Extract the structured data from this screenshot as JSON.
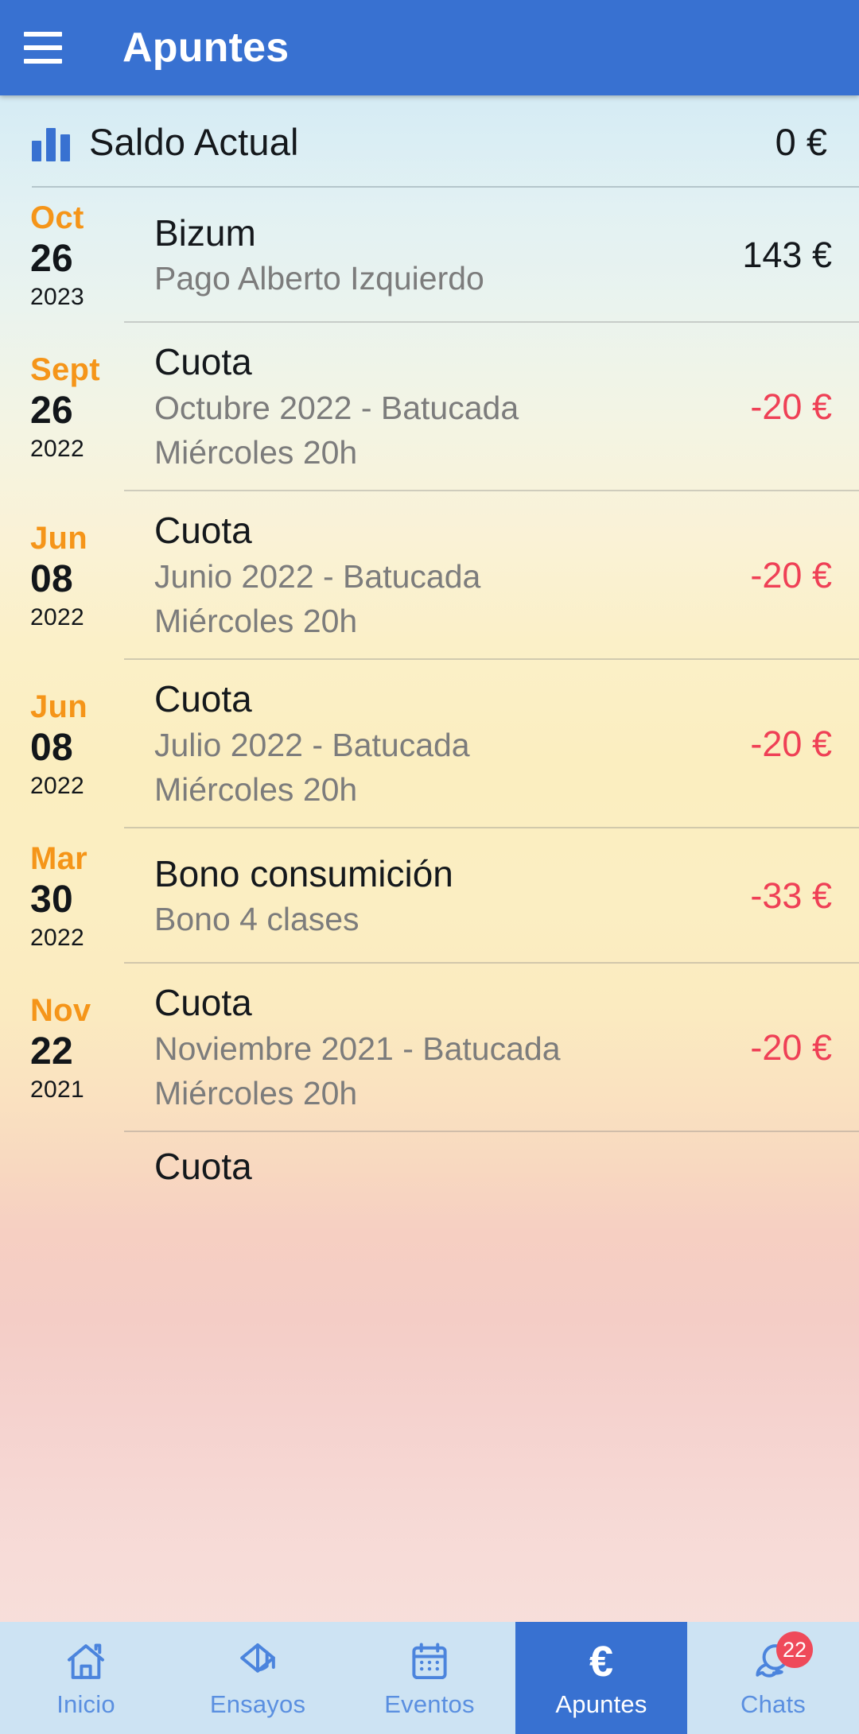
{
  "appbar": {
    "menu_icon": "hamburger-menu-icon",
    "title": "Apuntes"
  },
  "balance": {
    "icon": "bar-chart-icon",
    "label": "Saldo Actual",
    "value": "0 €"
  },
  "colors": {
    "primary_blue": "#3871d1",
    "nav_background": "#cde3f3",
    "month_orange": "#f59519",
    "negative_red": "#ef4056",
    "badge_red": "#ef4a5a",
    "subtitle_grey": "#7c7c7c"
  },
  "transactions": [
    {
      "month": "Oct",
      "day": "26",
      "year": "2023",
      "title": "Bizum",
      "sub1": "Pago Alberto Izquierdo",
      "sub2": "",
      "amount": "143 €",
      "negative": false
    },
    {
      "month": "Sept",
      "day": "26",
      "year": "2022",
      "title": "Cuota",
      "sub1": "Octubre 2022 - Batucada",
      "sub2": "Miércoles 20h",
      "amount": "-20 €",
      "negative": true
    },
    {
      "month": "Jun",
      "day": "08",
      "year": "2022",
      "title": "Cuota",
      "sub1": "Junio 2022 - Batucada",
      "sub2": "Miércoles 20h",
      "amount": "-20 €",
      "negative": true
    },
    {
      "month": "Jun",
      "day": "08",
      "year": "2022",
      "title": "Cuota",
      "sub1": "Julio 2022 - Batucada",
      "sub2": "Miércoles 20h",
      "amount": "-20 €",
      "negative": true
    },
    {
      "month": "Mar",
      "day": "30",
      "year": "2022",
      "title": "Bono consumición",
      "sub1": "Bono 4 clases",
      "sub2": "",
      "amount": "-33 €",
      "negative": true
    },
    {
      "month": "Nov",
      "day": "22",
      "year": "2021",
      "title": "Cuota",
      "sub1": "Noviembre 2021 - Batucada",
      "sub2": "Miércoles 20h",
      "amount": "-20 €",
      "negative": true
    }
  ],
  "partial_transaction": {
    "title": "Cuota"
  },
  "bottomnav": {
    "items": [
      {
        "label": "Inicio",
        "icon": "home-icon",
        "active": false,
        "badge": ""
      },
      {
        "label": "Ensayos",
        "icon": "graduation-cap-icon",
        "active": false,
        "badge": ""
      },
      {
        "label": "Eventos",
        "icon": "calendar-icon",
        "active": false,
        "badge": ""
      },
      {
        "label": "Apuntes",
        "icon": "euro-icon",
        "active": true,
        "badge": ""
      },
      {
        "label": "Chats",
        "icon": "chat-bubbles-icon",
        "active": false,
        "badge": "22"
      }
    ]
  }
}
